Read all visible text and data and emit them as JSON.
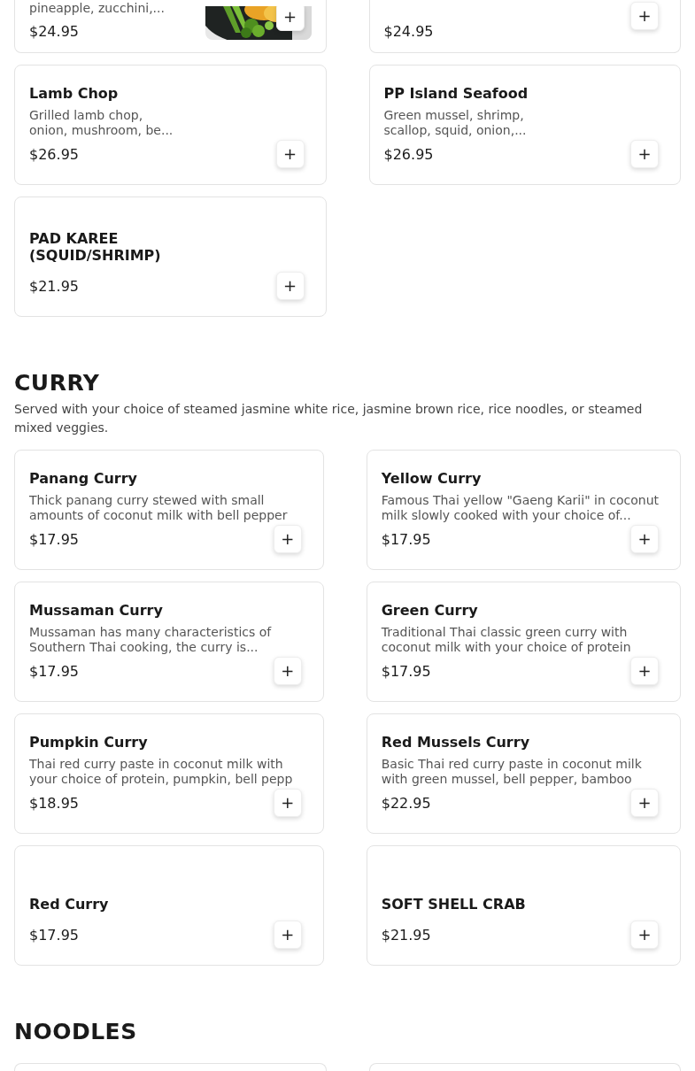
{
  "sections": [
    {
      "items": [
        {
          "kind": "cut_top",
          "description": "pineapple, zucchini,...",
          "price": "$24.95",
          "add": "+"
        },
        {
          "kind": "cut_top",
          "price": "$24.95",
          "add": "+"
        },
        {
          "kind": "full",
          "name": "Lamb Chop",
          "description": "Grilled lamb chop,\nonion, mushroom, be...",
          "price": "$26.95",
          "add": "+"
        },
        {
          "kind": "full",
          "name": "PP Island Seafood",
          "description": "Green mussel, shrimp,\nscallop, squid, onion,...",
          "price": "$26.95",
          "add": "+"
        },
        {
          "kind": "full",
          "name": "PAD KAREE\n(SQUID/SHRIMP)",
          "price": "$21.95",
          "add": "+"
        }
      ]
    },
    {
      "title": "CURRY",
      "description": "Served with your choice of steamed jasmine white rice, jasmine brown rice, rice noodles, or steamed mixed veggies.",
      "items": [
        {
          "kind": "full",
          "name": "Panang Curry",
          "description": "Thick panang curry stewed with small\namounts of coconut milk with bell pepper",
          "price": "$17.95",
          "add": "+"
        },
        {
          "kind": "full",
          "name": "Yellow Curry",
          "description": "Famous Thai yellow \"Gaeng Karii\" in coconut\nmilk slowly cooked with your choice of...",
          "price": "$17.95",
          "add": "+"
        },
        {
          "kind": "full",
          "name": "Mussaman Curry",
          "description": "Mussaman has many characteristics of\nSouthern Thai cooking, the curry is...",
          "price": "$17.95",
          "add": "+"
        },
        {
          "kind": "full",
          "name": "Green Curry",
          "description": "Traditional Thai classic green curry with\ncoconut milk with your choice of protein",
          "price": "$17.95",
          "add": "+"
        },
        {
          "kind": "full",
          "name": "Pumpkin Curry",
          "description": "Thai red curry paste in coconut milk with\nyour choice of protein, pumpkin, bell pepp",
          "price": "$18.95",
          "add": "+"
        },
        {
          "kind": "full",
          "name": "Red Mussels Curry",
          "description": "Basic Thai red curry paste in coconut milk\nwith green mussel, bell pepper, bamboo",
          "price": "$22.95",
          "add": "+"
        },
        {
          "kind": "full",
          "name": "Red Curry",
          "price": "$17.95",
          "add": "+"
        },
        {
          "kind": "full",
          "name": "SOFT SHELL CRAB",
          "price": "$21.95",
          "add": "+"
        }
      ]
    },
    {
      "title": "NOODLES",
      "items": [
        {
          "kind": "cut_bottom"
        },
        {
          "kind": "cut_bottom"
        }
      ]
    }
  ]
}
